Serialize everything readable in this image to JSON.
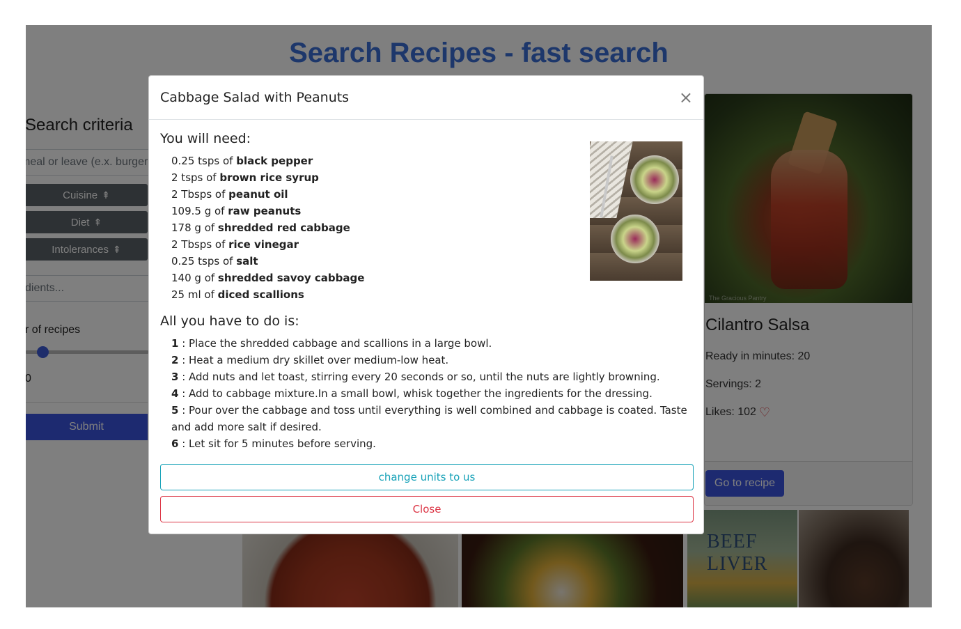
{
  "page": {
    "title": "Search Recipes - fast search"
  },
  "sidebar": {
    "heading": "Search criteria",
    "meal_placeholder": "meal or leave (e.x. burger",
    "filters": [
      {
        "label": "Cuisine",
        "icon": "sort-icon"
      },
      {
        "label": "Diet",
        "icon": "sort-icon"
      },
      {
        "label": "Intolerances",
        "icon": "sort-icon"
      }
    ],
    "ingredients_placeholder": "dients...",
    "number_label": "r of recipes",
    "slider_value": "0",
    "submit_label": "Submit",
    "colors": {
      "button": "#5a6268",
      "submit": "#3b55e0"
    }
  },
  "card": {
    "image_credit": "The Gracious Pantry",
    "title": "Cilantro Salsa",
    "ready": "Ready in minutes: 20",
    "servings": "Servings: 2",
    "likes": "Likes: 102",
    "likes_icon": "heart-icon",
    "button_label": "Go to recipe"
  },
  "tiles": {
    "liver_text": "BEEF LIVER"
  },
  "modal": {
    "title": "Cabbage Salad with Peanuts",
    "close_symbol": "×",
    "ingredients_heading": "You will need:",
    "ingredients": [
      {
        "amount": "0.25 tsps of ",
        "name": "black pepper"
      },
      {
        "amount": "2 tsps of ",
        "name": "brown rice syrup"
      },
      {
        "amount": "2 Tbsps of ",
        "name": "peanut oil"
      },
      {
        "amount": "109.5 g of ",
        "name": "raw peanuts"
      },
      {
        "amount": "178 g of ",
        "name": "shredded red cabbage"
      },
      {
        "amount": "2 Tbsps of ",
        "name": "rice vinegar"
      },
      {
        "amount": "0.25 tsps of ",
        "name": "salt"
      },
      {
        "amount": "140 g of ",
        "name": "shredded savoy cabbage"
      },
      {
        "amount": "25 ml of ",
        "name": "diced scallions"
      }
    ],
    "steps_heading": "All you have to do is:",
    "steps": [
      {
        "num": "1",
        "text": " : Place the shredded cabbage and scallions in a large bowl."
      },
      {
        "num": "2",
        "text": " : Heat a medium dry skillet over medium-low heat."
      },
      {
        "num": "3",
        "text": " : Add nuts and let toast, stirring every 20 seconds or so, until the nuts are lightly browning."
      },
      {
        "num": "4",
        "text": " : Add to cabbage mixture.In a small bowl, whisk together the ingredients for the dressing."
      },
      {
        "num": "5",
        "text": " : Pour over the cabbage and toss until everything is well combined and cabbage is coated. Taste and add more salt if desired."
      },
      {
        "num": "6",
        "text": " : Let sit for 5 minutes before serving."
      }
    ],
    "units_button": "change units to us",
    "close_button": "Close",
    "colors": {
      "units": "#17a2b8",
      "close": "#dc3545"
    }
  }
}
